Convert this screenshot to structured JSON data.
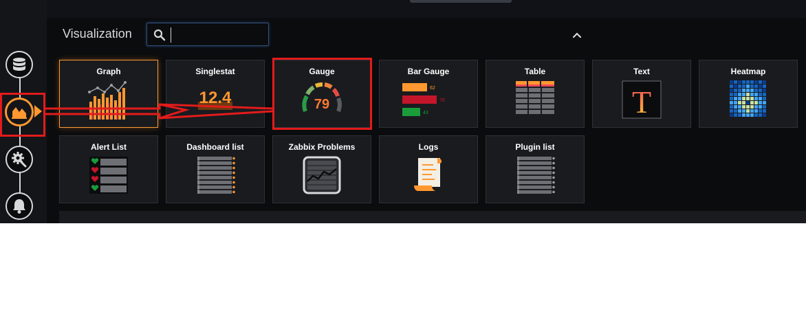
{
  "panel": {
    "title": "Visualization",
    "search_value": "",
    "search_placeholder": ""
  },
  "sidebar": {
    "items": [
      {
        "name": "queries",
        "icon": "database-icon"
      },
      {
        "name": "visualization",
        "icon": "chart-icon",
        "active": true
      },
      {
        "name": "general",
        "icon": "gear-icon"
      },
      {
        "name": "alert",
        "icon": "bell-icon"
      }
    ]
  },
  "visualizations": [
    {
      "label": "Graph",
      "icon": "graph-icon",
      "selected": true
    },
    {
      "label": "Singlestat",
      "icon": "singlestat-icon",
      "value": "12.4"
    },
    {
      "label": "Gauge",
      "icon": "gauge-icon",
      "value": "79"
    },
    {
      "label": "Bar Gauge",
      "icon": "bar-gauge-icon",
      "values": [
        "62",
        "76",
        "43"
      ]
    },
    {
      "label": "Table",
      "icon": "table-icon"
    },
    {
      "label": "Text",
      "icon": "text-icon",
      "glyph": "T"
    },
    {
      "label": "Heatmap",
      "icon": "heatmap-icon"
    },
    {
      "label": "Alert List",
      "icon": "alert-list-icon"
    },
    {
      "label": "Dashboard list",
      "icon": "dashboard-list-icon"
    },
    {
      "label": "Zabbix Problems",
      "icon": "zabbix-problems-icon"
    },
    {
      "label": "Logs",
      "icon": "logs-icon"
    },
    {
      "label": "Plugin list",
      "icon": "plugin-list-icon"
    }
  ],
  "colors": {
    "accent": "#ff9830",
    "annotation": "#e31b1b",
    "background": "#0b0c0e",
    "card": "#1a1b1f"
  }
}
